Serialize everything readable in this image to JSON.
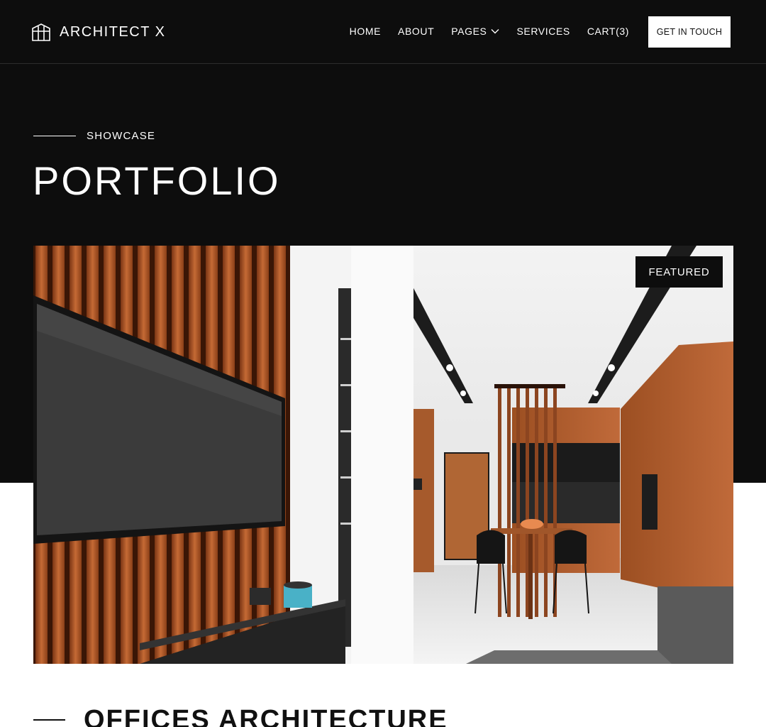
{
  "brand": {
    "name": "ARCHITECT X",
    "logo_icon": "building-icon"
  },
  "nav": {
    "items": [
      {
        "label": "HOME"
      },
      {
        "label": "ABOUT"
      },
      {
        "label": "PAGES",
        "icon": "chevron-down-icon"
      },
      {
        "label": "SERVICES"
      },
      {
        "label": "CART(3)"
      }
    ],
    "cta_label": "GET IN TOUCH"
  },
  "hero": {
    "eyebrow": "SHOWCASE",
    "title": "PORTFOLIO"
  },
  "featured_project": {
    "badge": "FEATURED",
    "title": "OFFICES ARCHITECTURE",
    "image_subject": "modern apartment interior with wood slat wall, TV and dining area"
  },
  "colors": {
    "background_dark": "#0d0d0d",
    "background_light": "#ffffff",
    "text_light": "#ffffff",
    "text_dark": "#111111",
    "accent_wood": "#b5602e"
  }
}
